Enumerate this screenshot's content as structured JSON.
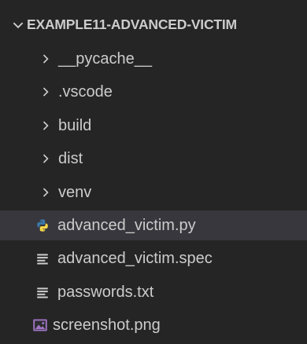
{
  "explorer": {
    "root_label": "EXAMPLE11-ADVANCED-VICTIM",
    "items": [
      {
        "label": "__pycache__",
        "type": "folder",
        "icon": "chevron-right-icon"
      },
      {
        "label": ".vscode",
        "type": "folder",
        "icon": "chevron-right-icon"
      },
      {
        "label": "build",
        "type": "folder",
        "icon": "chevron-right-icon"
      },
      {
        "label": "dist",
        "type": "folder",
        "icon": "chevron-right-icon"
      },
      {
        "label": "venv",
        "type": "folder",
        "icon": "chevron-right-icon"
      },
      {
        "label": "advanced_victim.py",
        "type": "file",
        "icon": "python-icon",
        "selected": true
      },
      {
        "label": "advanced_victim.spec",
        "type": "file",
        "icon": "text-file-icon"
      },
      {
        "label": "passwords.txt",
        "type": "file",
        "icon": "text-file-icon"
      },
      {
        "label": "screenshot.png",
        "type": "file",
        "icon": "image-file-icon"
      }
    ]
  },
  "colors": {
    "background": "#252526",
    "selected_row": "#37373d",
    "text": "#cccccc",
    "python_blue": "#3c78aa",
    "python_yellow": "#f7d84a",
    "image_icon": "#a074c4"
  }
}
